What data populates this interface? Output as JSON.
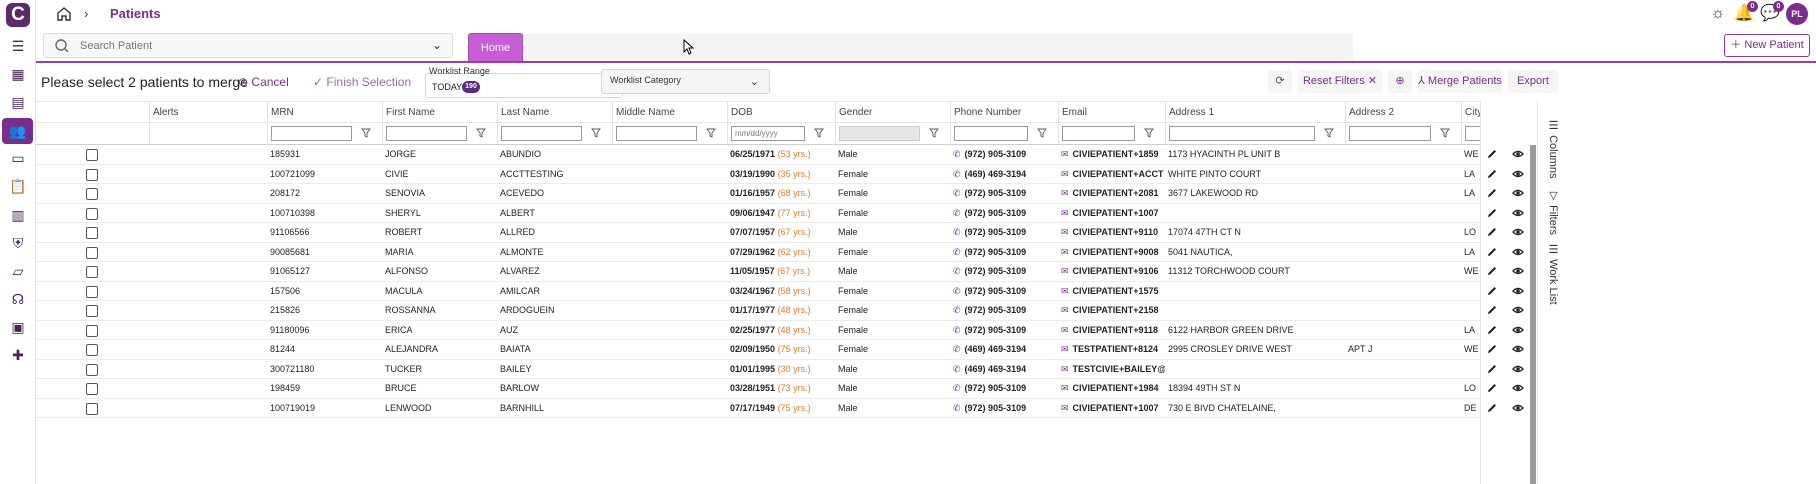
{
  "app": {
    "logo_letter": "C"
  },
  "breadcrumb": {
    "separator": "›",
    "page_title": "Patients"
  },
  "topbar": {
    "notifications_count": "0",
    "messages_count": "0",
    "avatar_initials": "PL"
  },
  "search": {
    "placeholder": "Search Patient"
  },
  "tabs": [
    {
      "label": "Home"
    }
  ],
  "new_patient_label": "New Patient",
  "toolbar": {
    "merge_message": "Please select 2 patients to merge",
    "cancel_label": "Cancel",
    "finish_label": "Finish Selection",
    "worklist_range_label": "Worklist Range",
    "worklist_range_value": "TODAY",
    "worklist_range_count": "190",
    "worklist_category_placeholder": "Worklist Category",
    "reset_filters_label": "Reset Filters",
    "merge_patients_label": "Merge Patients",
    "export_label": "Export"
  },
  "columns": [
    "Alerts",
    "MRN",
    "First Name",
    "Last Name",
    "Middle Name",
    "DOB",
    "Gender",
    "Phone Number",
    "Email",
    "Address 1",
    "Address 2",
    "City"
  ],
  "dob_placeholder": "mm/dd/yyyy",
  "rows": [
    {
      "mrn": "185931",
      "first": "JORGE",
      "last": "ABUNDIO",
      "dob": "06/25/1971",
      "age": "(53 yrs.)",
      "gender": "Male",
      "phone": "(972) 905-3109",
      "email": "CIVIEPATIENT+1859",
      "addr1": "1173 HYACINTH PL UNIT B",
      "addr2": "",
      "city": "WE"
    },
    {
      "mrn": "100721099",
      "first": "CIVIE",
      "last": "ACCTTESTING",
      "dob": "03/19/1990",
      "age": "(35 yrs.)",
      "gender": "Female",
      "phone": "(469) 469-3194",
      "email": "CIVIEPATIENT+ACCT",
      "addr1": "WHITE PINTO COURT",
      "addr2": "",
      "city": "LA"
    },
    {
      "mrn": "208172",
      "first": "SENOVIA",
      "last": "ACEVEDO",
      "dob": "01/16/1957",
      "age": "(68 yrs.)",
      "gender": "Female",
      "phone": "(972) 905-3109",
      "email": "CIVIEPATIENT+2081",
      "addr1": "3677 LAKEWOOD RD",
      "addr2": "",
      "city": "LA"
    },
    {
      "mrn": "100710398",
      "first": "SHERYL",
      "last": "ALBERT",
      "dob": "09/06/1947",
      "age": "(77 yrs.)",
      "gender": "Female",
      "phone": "(972) 905-3109",
      "email": "CIVIEPATIENT+1007",
      "addr1": "",
      "addr2": "",
      "city": ""
    },
    {
      "mrn": "91106566",
      "first": "ROBERT",
      "last": "ALLRED",
      "dob": "07/07/1957",
      "age": "(67 yrs.)",
      "gender": "Male",
      "phone": "(972) 905-3109",
      "email": "CIVIEPATIENT+9110",
      "addr1": "17074 47TH CT N",
      "addr2": "",
      "city": "LO"
    },
    {
      "mrn": "90085681",
      "first": "MARIA",
      "last": "ALMONTE",
      "dob": "07/29/1962",
      "age": "(62 yrs.)",
      "gender": "Female",
      "phone": "(972) 905-3109",
      "email": "CIVIEPATIENT+9008",
      "addr1": "5041 NAUTICA,",
      "addr2": "",
      "city": "LA"
    },
    {
      "mrn": "91065127",
      "first": "ALFONSO",
      "last": "ALVAREZ",
      "dob": "11/05/1957",
      "age": "(67 yrs.)",
      "gender": "Male",
      "phone": "(972) 905-3109",
      "email": "CIVIEPATIENT+9106",
      "addr1": "11312 TORCHWOOD COURT",
      "addr2": "",
      "city": "WE"
    },
    {
      "mrn": "157506",
      "first": "MACULA",
      "last": "AMILCAR",
      "dob": "03/24/1967",
      "age": "(58 yrs.)",
      "gender": "Female",
      "phone": "(972) 905-3109",
      "email": "CIVIEPATIENT+1575",
      "addr1": "",
      "addr2": "",
      "city": ""
    },
    {
      "mrn": "215826",
      "first": "ROSSANNA",
      "last": "ARDOGUEIN",
      "dob": "01/17/1977",
      "age": "(48 yrs.)",
      "gender": "Female",
      "phone": "(972) 905-3109",
      "email": "CIVIEPATIENT+2158",
      "addr1": "",
      "addr2": "",
      "city": ""
    },
    {
      "mrn": "91180096",
      "first": "ERICA",
      "last": "AUZ",
      "dob": "02/25/1977",
      "age": "(48 yrs.)",
      "gender": "Female",
      "phone": "(972) 905-3109",
      "email": "CIVIEPATIENT+9118",
      "addr1": "6122 HARBOR GREEN DRIVE",
      "addr2": "",
      "city": "LA"
    },
    {
      "mrn": "81244",
      "first": "ALEJANDRA",
      "last": "BAIATA",
      "dob": "02/09/1950",
      "age": "(75 yrs.)",
      "gender": "Female",
      "phone": "(469) 469-3194",
      "email": "TESTPATIENT+8124",
      "addr1": "2995 CROSLEY DRIVE WEST",
      "addr2": "APT J",
      "city": "WE"
    },
    {
      "mrn": "300721180",
      "first": "TUCKER",
      "last": "BAILEY",
      "dob": "01/01/1995",
      "age": "(30 yrs.)",
      "gender": "Male",
      "phone": "(469) 469-3194",
      "email": "TESTCIVIE+BAILEY@",
      "addr1": "",
      "addr2": "",
      "city": ""
    },
    {
      "mrn": "198459",
      "first": "BRUCE",
      "last": "BARLOW",
      "dob": "03/28/1951",
      "age": "(73 yrs.)",
      "gender": "Male",
      "phone": "(972) 905-3109",
      "email": "CIVIEPATIENT+1984",
      "addr1": "18394 49TH ST N",
      "addr2": "",
      "city": "LO"
    },
    {
      "mrn": "100719019",
      "first": "LENWOOD",
      "last": "BARNHILL",
      "dob": "07/17/1949",
      "age": "(75 yrs.)",
      "gender": "Male",
      "phone": "(972) 905-3109",
      "email": "CIVIEPATIENT+1007",
      "addr1": "730 E BIVD CHATELAINE,",
      "addr2": "",
      "city": "DE"
    }
  ],
  "side_panel": {
    "columns_label": "Columns",
    "filters_label": "Filters",
    "worklist_label": "Work List"
  },
  "colors": {
    "accent": "#7b2d8e",
    "tab_active": "#c85ed7",
    "age_text": "#e07a2a"
  }
}
